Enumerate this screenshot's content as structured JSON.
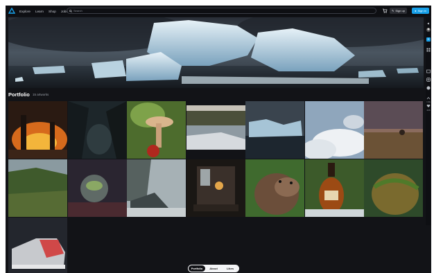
{
  "nav": {
    "links": [
      "Explore",
      "Learn",
      "Shop",
      "Jobs"
    ],
    "search_placeholder": "Search",
    "signup_label": "Sign up",
    "signin_label": "Sign in",
    "cart_icon": "cart-icon",
    "logo_icon": "artstation-logo"
  },
  "portfolio": {
    "title": "Portfolio",
    "count": "15 artworks"
  },
  "rail": {
    "icons": [
      "menu-icon",
      "avatar",
      "add-icon",
      "grid-icon",
      "gallery-icon",
      "instagram-icon",
      "chat-icon",
      "share-icon",
      "likes-icon"
    ],
    "counts": [
      "1.9k",
      "206"
    ]
  },
  "artworks": [
    "burning-village",
    "dark-forest-cave",
    "mushroom-house",
    "rocky-coast",
    "glacier-bay",
    "cloudscape",
    "evening-field",
    "green-hills",
    "terrarium-orb",
    "foggy-coast-rock",
    "gallery-interior",
    "otter-portrait",
    "cognac-bottle",
    "mossy-stone",
    "sneaker"
  ],
  "tabs": [
    "Portfolio",
    "About",
    "Likes"
  ],
  "colors": {
    "accent": "#18a0e8",
    "background": "#121317"
  }
}
